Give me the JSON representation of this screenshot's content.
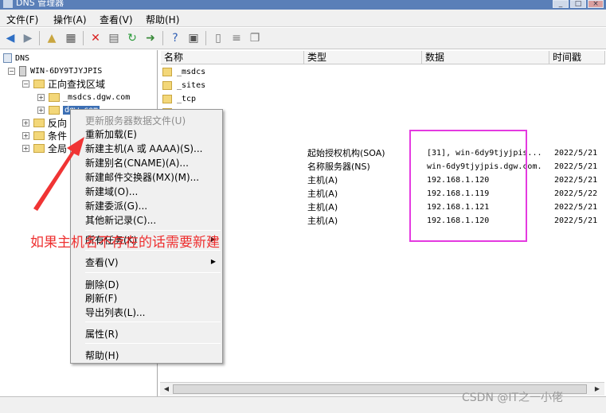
{
  "window": {
    "title": "DNS 管理器"
  },
  "menu": [
    "文件(F)",
    "操作(A)",
    "查看(V)",
    "帮助(H)"
  ],
  "toolbar": [
    "back-icon",
    "forward-icon",
    "up-folder-icon",
    "show-tree-icon",
    "delete-icon",
    "properties-icon",
    "refresh-icon",
    "export-icon",
    "help-icon",
    "console-icon",
    "record-icon",
    "list-icon",
    "copy-icon"
  ],
  "tree": {
    "root": "DNS",
    "server": "WIN-6DY9TJYJPIS",
    "forward_zones": "正向查找区域",
    "zone_msdcs": "_msdcs.dgw.com",
    "zone_dgw": "dgw.com",
    "reverse_zones": "反向",
    "conditional": "条件",
    "global": "全局"
  },
  "list": {
    "columns": [
      "名称",
      "类型",
      "数据",
      "时间戳"
    ],
    "rows": [
      {
        "name": "_msdcs",
        "type": "",
        "data": "",
        "time": "",
        "icon": "folder"
      },
      {
        "name": "_sites",
        "type": "",
        "data": "",
        "time": "",
        "icon": "folder"
      },
      {
        "name": "_tcp",
        "type": "",
        "data": "",
        "time": "",
        "icon": "folder"
      },
      {
        "name": "",
        "type": "",
        "data": "",
        "time": "",
        "icon": "folder"
      },
      {
        "name": "Zones",
        "type": "",
        "data": "",
        "time": "",
        "icon": ""
      },
      {
        "name": "Zones",
        "type": "",
        "data": "",
        "time": "",
        "icon": ""
      },
      {
        "name": "夫相同)",
        "type": "起始授权机构(SOA)",
        "data": "[31], win-6dy9tjyjpis...",
        "time": "2022/5/21",
        "icon": ""
      },
      {
        "name": "夫相同)",
        "type": "名称服务器(NS)",
        "data": "win-6dy9tjyjpis.dgw.com.",
        "time": "2022/5/21",
        "icon": ""
      },
      {
        "name": "夫相同)",
        "type": "主机(A)",
        "data": "192.168.1.120",
        "time": "2022/5/21",
        "icon": ""
      },
      {
        "name": "5A0A0",
        "type": "主机(A)",
        "data": "192.168.1.119",
        "time": "2022/5/22",
        "icon": ""
      },
      {
        "name": "",
        "type": "主机(A)",
        "data": "192.168.1.121",
        "time": "2022/5/21",
        "icon": ""
      },
      {
        "name": "yjpis",
        "type": "主机(A)",
        "data": "192.168.1.120",
        "time": "2022/5/21",
        "icon": ""
      }
    ]
  },
  "context_menu": [
    {
      "label": "更新服务器数据文件(U)",
      "disabled": true
    },
    {
      "label": "重新加载(E)"
    },
    {
      "label": "新建主机(A 或 AAAA)(S)..."
    },
    {
      "label": "新建别名(CNAME)(A)..."
    },
    {
      "label": "新建邮件交换器(MX)(M)..."
    },
    {
      "label": "新建域(O)..."
    },
    {
      "label": "新建委派(G)..."
    },
    {
      "label": "其他新记录(C)..."
    },
    {
      "label": "所有任务(K)",
      "submenu": true
    },
    {
      "label": "查看(V)",
      "submenu": true
    },
    {
      "label": "删除(D)"
    },
    {
      "label": "刷新(F)"
    },
    {
      "label": "导出列表(L)..."
    },
    {
      "label": "属性(R)"
    },
    {
      "label": "帮助(H)"
    }
  ],
  "annotation": "如果主机名不存在的话需要新建",
  "watermark": "CSDN @IT之一小佬",
  "colors": {
    "highlight": "#e43ae0",
    "annotation": "#ee3030",
    "selection": "#3c6fb4"
  }
}
